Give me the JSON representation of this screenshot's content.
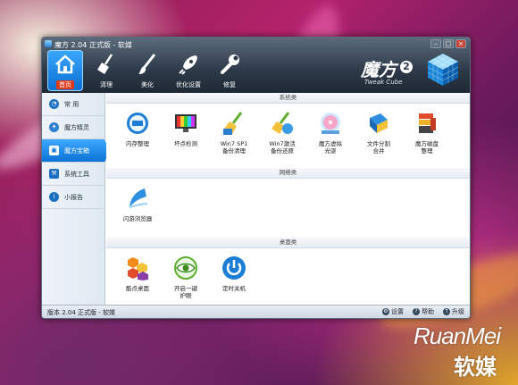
{
  "window": {
    "title": "魔方 2.04 正式版 - 软媒",
    "min": "–",
    "max": "□",
    "close": "×"
  },
  "toolbar": [
    {
      "label": "首页",
      "icon": "home-icon"
    },
    {
      "label": "清理",
      "icon": "broom-icon"
    },
    {
      "label": "美化",
      "icon": "brush-icon"
    },
    {
      "label": "优化设置",
      "icon": "rocket-icon"
    },
    {
      "label": "修复",
      "icon": "wrench-icon"
    }
  ],
  "logo": {
    "text": "魔方",
    "number": "2",
    "sub": "Tweak Cube"
  },
  "sidebar": [
    {
      "label": "常 用",
      "icon": "clock-icon"
    },
    {
      "label": "魔方精灵",
      "icon": "sprite-icon"
    },
    {
      "label": "魔方宝箱",
      "icon": "treasure-icon"
    },
    {
      "label": "系统工具",
      "icon": "tools-icon"
    },
    {
      "label": "小报告",
      "icon": "info-icon"
    }
  ],
  "sections": [
    {
      "title": "系统类",
      "tools": [
        {
          "label": "内存整理",
          "icon": "memory-icon"
        },
        {
          "label": "坏点检测",
          "icon": "monitor-icon"
        },
        {
          "label": "Win7 SP1\n备份清理",
          "icon": "sp1-clean-icon"
        },
        {
          "label": "Win7激活\n备份还原",
          "icon": "activation-icon"
        },
        {
          "label": "魔方虚拟\n光驱",
          "icon": "virtual-drive-icon"
        },
        {
          "label": "文件分割\n合并",
          "icon": "file-split-icon"
        },
        {
          "label": "魔方磁盘\n整理",
          "icon": "disk-defrag-icon"
        }
      ]
    },
    {
      "title": "网络类",
      "tools": [
        {
          "label": "闪游浏览器",
          "icon": "browser-icon"
        }
      ]
    },
    {
      "title": "桌面类",
      "tools": [
        {
          "label": "酷点桌面",
          "icon": "desktop-icon"
        },
        {
          "label": "开启一键\n护眼",
          "icon": "eye-care-icon"
        },
        {
          "label": "定时关机",
          "icon": "power-icon"
        }
      ]
    }
  ],
  "statusbar": {
    "version": "版本 2.04 正式版 - 软媒",
    "settings": "设置",
    "help": "帮助",
    "update": "升级"
  },
  "watermark": {
    "en": "RuanMei",
    "cn": "软媒"
  }
}
